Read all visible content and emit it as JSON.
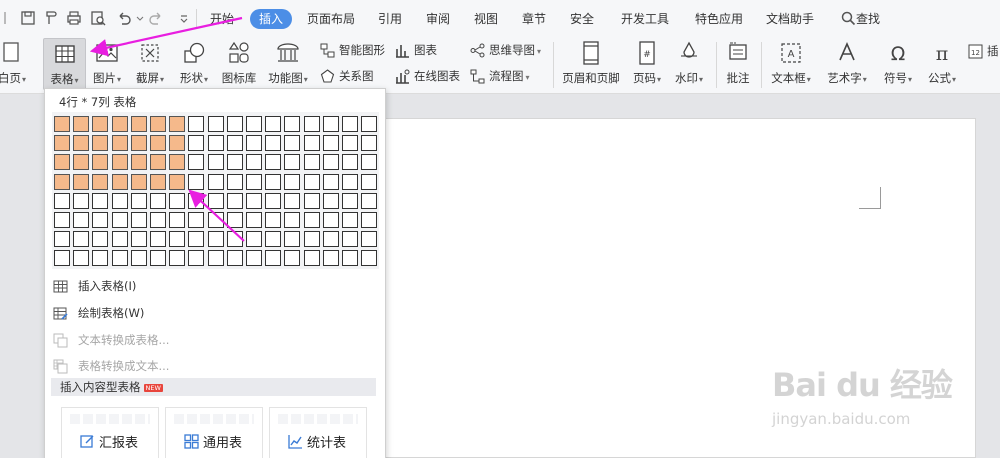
{
  "menubar": {
    "items": [
      "开始",
      "插入",
      "页面布局",
      "引用",
      "审阅",
      "视图",
      "章节",
      "安全",
      "开发工具",
      "特色应用",
      "文档助手"
    ],
    "active": "插入",
    "search_label": "查找"
  },
  "ribbon": {
    "left_partial": "白页",
    "table": "表格",
    "picture": "图片",
    "screenshot": "截屏",
    "shapes": "形状",
    "icon_library": "图标库",
    "function_chart": "功能图",
    "smart_art": "智能图形",
    "chart": "图表",
    "relation_map": "关系图",
    "online_chart": "在线图表",
    "mind_map": "思维导图",
    "flowchart": "流程图",
    "header_footer": "页眉和页脚",
    "page_number": "页码",
    "watermark": "水印",
    "comment": "批注",
    "textbox": "文本框",
    "word_art": "艺术字",
    "symbol": "符号",
    "formula": "公式",
    "right_partial": "插"
  },
  "dropdown": {
    "grid_size": "4行 * 7列 表格",
    "grid_rows": 8,
    "grid_cols": 17,
    "selected_rows": 4,
    "selected_cols": 7,
    "insert_table": "插入表格(I)",
    "draw_table": "绘制表格(W)",
    "text_to_table": "文本转换成表格...",
    "table_to_text": "表格转换成文本...",
    "content_table_header": "插入内容型表格",
    "new_badge": "NEW",
    "templates": [
      "汇报表",
      "通用表",
      "统计表"
    ]
  },
  "watermark": {
    "logo": "Bai du 经验",
    "url": "jingyan.baidu.com"
  },
  "colors": {
    "accent": "#4c8ee6",
    "selected_cell": "#f5b98b",
    "annotation_arrow": "#e81ee0",
    "new_badge": "#e8453c"
  }
}
